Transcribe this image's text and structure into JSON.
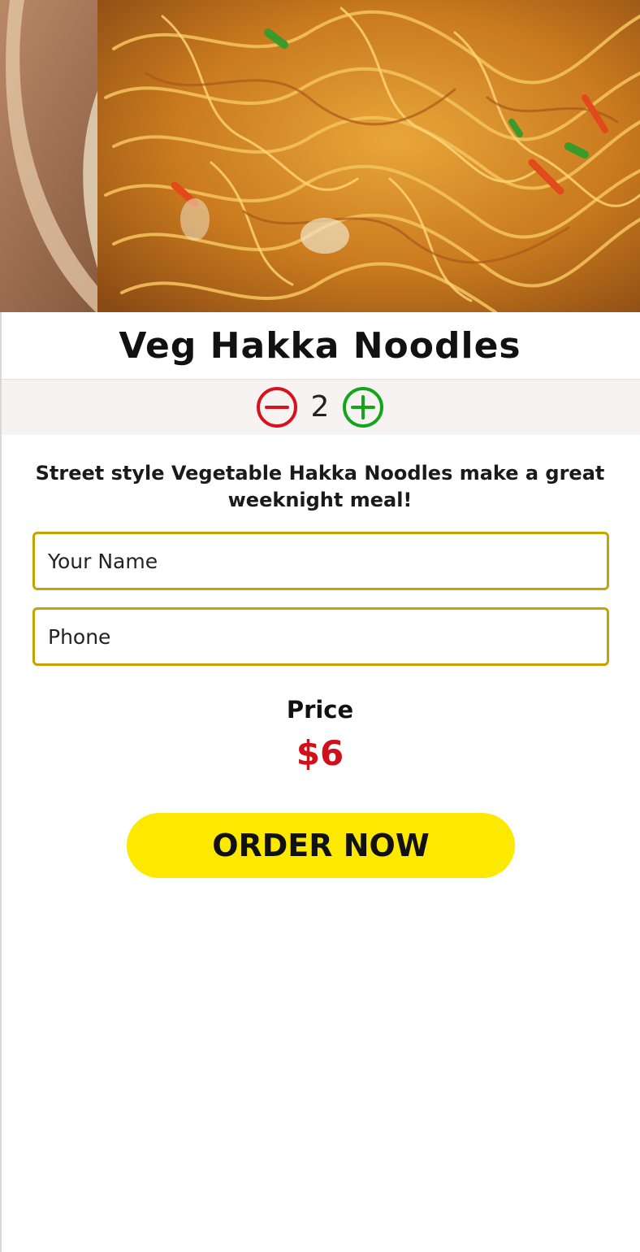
{
  "product": {
    "title": "Veg Hakka Noodles",
    "image_icon": "noodles-bowl-photo",
    "description": "Street style Vegetable Hakka Noodles make a great weeknight meal!"
  },
  "quantity": {
    "value": "2",
    "decrement_icon": "minus-circle-icon",
    "increment_icon": "plus-circle-icon",
    "decrement_color": "#d8121c",
    "increment_color": "#13a51a"
  },
  "form": {
    "name_placeholder": "Your Name",
    "phone_placeholder": "Phone",
    "field_border_color": "#c8a200"
  },
  "pricing": {
    "label": "Price",
    "value": "$6",
    "value_color": "#d0111b"
  },
  "actions": {
    "order_label": "ORDER NOW",
    "order_color": "#fde800"
  }
}
